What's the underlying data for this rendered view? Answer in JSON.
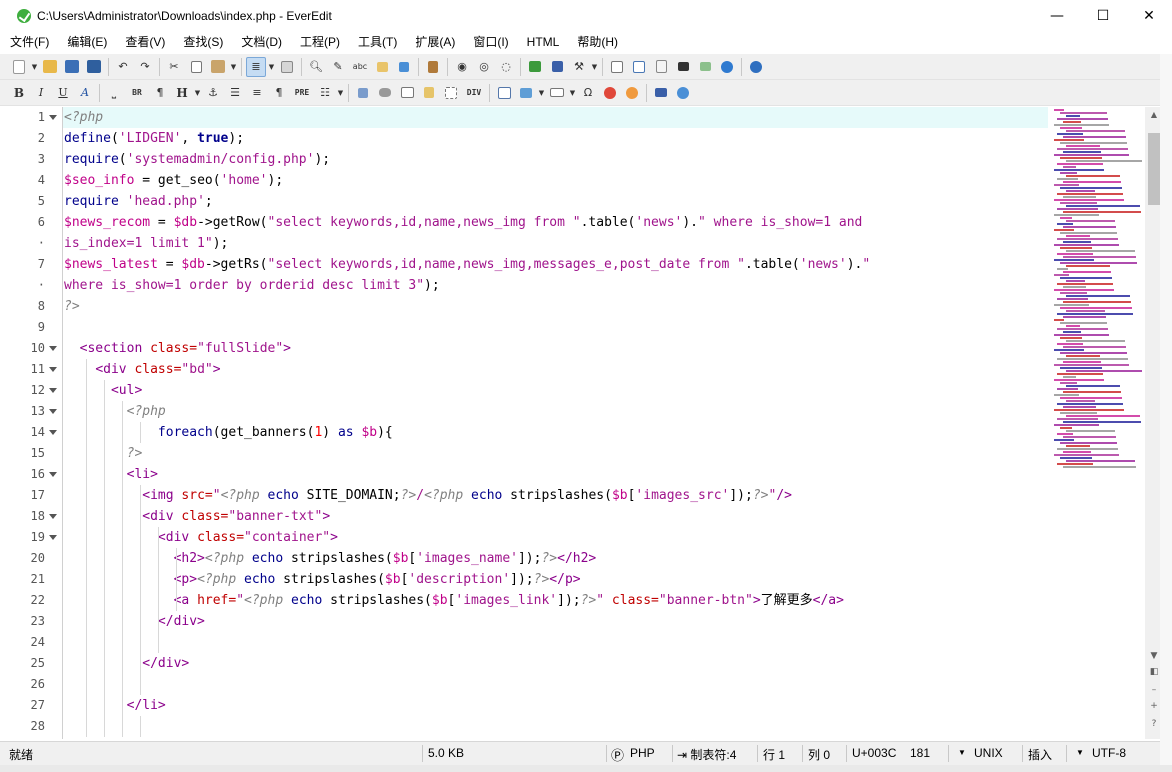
{
  "window": {
    "title": "C:\\Users\\Administrator\\Downloads\\index.php - EverEdit",
    "controls": [
      "—",
      "☐",
      "✕"
    ]
  },
  "menu": [
    "文件(F)",
    "编辑(E)",
    "查看(V)",
    "查找(S)",
    "文档(D)",
    "工程(P)",
    "工具(T)",
    "扩展(A)",
    "窗口(I)",
    "HTML",
    "帮助(H)"
  ],
  "toolbar1": {
    "icons": [
      "new-file-icon",
      "open-folder-icon",
      "save-icon",
      "save-all-icon",
      "undo-icon",
      "redo-icon",
      "cut-icon",
      "copy-icon",
      "paste-icon",
      "word-wrap-icon",
      "find-icon",
      "replace-icon",
      "spell-check-icon",
      "find-in-files-icon",
      "structure-icon",
      "column-mode-icon",
      "record-macro-icon",
      "play-macro-icon",
      "macro-list-icon",
      "plugin-icon",
      "panel-icon",
      "tools-icon",
      "explorer-icon",
      "outline-icon",
      "clipboard-icon",
      "console-icon",
      "grid-icon",
      "browser-icon",
      "help-icon"
    ]
  },
  "toolbar2": {
    "labels": [
      "B",
      "I",
      "U",
      "A",
      "BR",
      "¶",
      "H",
      "PRE",
      "DIV",
      "Ω"
    ]
  },
  "editor": {
    "gutter": [
      {
        "n": "1",
        "fold": true
      },
      {
        "n": "2",
        "fold": false
      },
      {
        "n": "3",
        "fold": false
      },
      {
        "n": "4",
        "fold": false
      },
      {
        "n": "5",
        "fold": false
      },
      {
        "n": "6",
        "fold": false
      },
      {
        "n": "·",
        "fold": false
      },
      {
        "n": "7",
        "fold": false
      },
      {
        "n": "·",
        "fold": false
      },
      {
        "n": "8",
        "fold": false
      },
      {
        "n": "9",
        "fold": false
      },
      {
        "n": "10",
        "fold": true
      },
      {
        "n": "11",
        "fold": true
      },
      {
        "n": "12",
        "fold": true
      },
      {
        "n": "13",
        "fold": true
      },
      {
        "n": "14",
        "fold": true
      },
      {
        "n": "15",
        "fold": false
      },
      {
        "n": "16",
        "fold": true
      },
      {
        "n": "17",
        "fold": false
      },
      {
        "n": "18",
        "fold": true
      },
      {
        "n": "19",
        "fold": true
      },
      {
        "n": "20",
        "fold": false
      },
      {
        "n": "21",
        "fold": false
      },
      {
        "n": "22",
        "fold": false
      },
      {
        "n": "23",
        "fold": false
      },
      {
        "n": "24",
        "fold": false
      },
      {
        "n": "25",
        "fold": false
      },
      {
        "n": "26",
        "fold": false
      },
      {
        "n": "27",
        "fold": false
      },
      {
        "n": "28",
        "fold": false
      }
    ],
    "lines": [
      {
        "guides": [],
        "current": true,
        "tokens": [
          [
            "php",
            "<?php"
          ]
        ]
      },
      {
        "guides": [],
        "tokens": [
          [
            "kw",
            "define"
          ],
          [
            "plain",
            "("
          ],
          [
            "str",
            "'LIDGEN'"
          ],
          [
            "plain",
            ", "
          ],
          [
            "bold",
            "true"
          ],
          [
            "plain",
            ");"
          ]
        ]
      },
      {
        "guides": [],
        "tokens": [
          [
            "kw",
            "require"
          ],
          [
            "plain",
            "("
          ],
          [
            "str",
            "'systemadmin/config.php'"
          ],
          [
            "plain",
            ");"
          ]
        ]
      },
      {
        "guides": [],
        "tokens": [
          [
            "var",
            "$seo_info"
          ],
          [
            "plain",
            " = get_seo("
          ],
          [
            "str",
            "'home'"
          ],
          [
            "plain",
            ");"
          ]
        ]
      },
      {
        "guides": [],
        "tokens": [
          [
            "kw",
            "require"
          ],
          [
            "plain",
            " "
          ],
          [
            "str",
            "'head.php'"
          ],
          [
            "plain",
            ";"
          ]
        ]
      },
      {
        "guides": [],
        "tokens": [
          [
            "var",
            "$news_recom"
          ],
          [
            "plain",
            " = "
          ],
          [
            "var",
            "$db"
          ],
          [
            "plain",
            "->getRow("
          ],
          [
            "str",
            "\"select keywords,id,name,news_img from \""
          ],
          [
            "plain",
            ".table("
          ],
          [
            "str",
            "'news'"
          ],
          [
            "plain",
            ")."
          ],
          [
            "str",
            "\" where is_show=1 and"
          ]
        ]
      },
      {
        "guides": [],
        "tokens": [
          [
            "str",
            "is_index=1 limit 1\""
          ],
          [
            "plain",
            ");"
          ]
        ]
      },
      {
        "guides": [],
        "tokens": [
          [
            "var",
            "$news_latest"
          ],
          [
            "plain",
            " = "
          ],
          [
            "var",
            "$db"
          ],
          [
            "plain",
            "->getRs("
          ],
          [
            "str",
            "\"select keywords,id,name,news_img,messages_e,post_date from \""
          ],
          [
            "plain",
            ".table("
          ],
          [
            "str",
            "'news'"
          ],
          [
            "plain",
            ")."
          ],
          [
            "str",
            "\""
          ]
        ]
      },
      {
        "guides": [],
        "tokens": [
          [
            "str",
            "where is_show=1 order by orderid desc limit 3\""
          ],
          [
            "plain",
            ");"
          ]
        ]
      },
      {
        "guides": [],
        "tokens": [
          [
            "php",
            "?>"
          ]
        ]
      },
      {
        "guides": [],
        "tokens": []
      },
      {
        "guides": [],
        "tokens": [
          [
            "plain",
            "  "
          ],
          [
            "tag",
            "<section "
          ],
          [
            "attr",
            "class="
          ],
          [
            "str",
            "\"fullSlide\""
          ],
          [
            "tag",
            ">"
          ]
        ]
      },
      {
        "guides": [
          22
        ],
        "tokens": [
          [
            "plain",
            "    "
          ],
          [
            "tag",
            "<div "
          ],
          [
            "attr",
            "class="
          ],
          [
            "str",
            "\"bd\""
          ],
          [
            "tag",
            ">"
          ]
        ]
      },
      {
        "guides": [
          22,
          40
        ],
        "tokens": [
          [
            "plain",
            "      "
          ],
          [
            "tag",
            "<ul>"
          ]
        ]
      },
      {
        "guides": [
          22,
          40,
          58
        ],
        "tokens": [
          [
            "plain",
            "        "
          ],
          [
            "php",
            "<?php"
          ]
        ]
      },
      {
        "guides": [
          22,
          40,
          58,
          76
        ],
        "tokens": [
          [
            "plain",
            "            "
          ],
          [
            "kw",
            "foreach"
          ],
          [
            "plain",
            "(get_banners("
          ],
          [
            "num",
            "1"
          ],
          [
            "plain",
            ") "
          ],
          [
            "kw",
            "as"
          ],
          [
            "plain",
            " "
          ],
          [
            "var",
            "$b"
          ],
          [
            "plain",
            "){"
          ]
        ]
      },
      {
        "guides": [
          22,
          40,
          58
        ],
        "tokens": [
          [
            "plain",
            "        "
          ],
          [
            "php",
            "?>"
          ]
        ]
      },
      {
        "guides": [
          22,
          40,
          58
        ],
        "tokens": [
          [
            "plain",
            "        "
          ],
          [
            "tag",
            "<li>"
          ]
        ]
      },
      {
        "guides": [
          22,
          40,
          58,
          76
        ],
        "tokens": [
          [
            "plain",
            "          "
          ],
          [
            "tag",
            "<img "
          ],
          [
            "attr",
            "src="
          ],
          [
            "str",
            "\""
          ],
          [
            "php",
            "<?php"
          ],
          [
            "plain",
            " "
          ],
          [
            "kw",
            "echo"
          ],
          [
            "plain",
            " SITE_DOMAIN;"
          ],
          [
            "php",
            "?>"
          ],
          [
            "str",
            "/"
          ],
          [
            "php",
            "<?php"
          ],
          [
            "plain",
            " "
          ],
          [
            "kw",
            "echo"
          ],
          [
            "plain",
            " stripslashes("
          ],
          [
            "var",
            "$b"
          ],
          [
            "plain",
            "["
          ],
          [
            "str",
            "'images_src'"
          ],
          [
            "plain",
            "]);"
          ],
          [
            "php",
            "?>"
          ],
          [
            "str",
            "\""
          ],
          [
            "tag",
            "/>"
          ]
        ]
      },
      {
        "guides": [
          22,
          40,
          58,
          76
        ],
        "tokens": [
          [
            "plain",
            "          "
          ],
          [
            "tag",
            "<div "
          ],
          [
            "attr",
            "class="
          ],
          [
            "str",
            "\"banner-txt\""
          ],
          [
            "tag",
            ">"
          ]
        ]
      },
      {
        "guides": [
          22,
          40,
          58,
          76,
          94
        ],
        "tokens": [
          [
            "plain",
            "            "
          ],
          [
            "tag",
            "<div "
          ],
          [
            "attr",
            "class="
          ],
          [
            "str",
            "\"container\""
          ],
          [
            "tag",
            ">"
          ]
        ]
      },
      {
        "guides": [
          22,
          40,
          58,
          76,
          94,
          112
        ],
        "tokens": [
          [
            "plain",
            "              "
          ],
          [
            "tag",
            "<h2>"
          ],
          [
            "php",
            "<?php"
          ],
          [
            "plain",
            " "
          ],
          [
            "kw",
            "echo"
          ],
          [
            "plain",
            " stripslashes("
          ],
          [
            "var",
            "$b"
          ],
          [
            "plain",
            "["
          ],
          [
            "str",
            "'images_name'"
          ],
          [
            "plain",
            "]);"
          ],
          [
            "php",
            "?>"
          ],
          [
            "tag",
            "</h2>"
          ]
        ]
      },
      {
        "guides": [
          22,
          40,
          58,
          76,
          94,
          112
        ],
        "tokens": [
          [
            "plain",
            "              "
          ],
          [
            "tag",
            "<p>"
          ],
          [
            "php",
            "<?php"
          ],
          [
            "plain",
            " "
          ],
          [
            "kw",
            "echo"
          ],
          [
            "plain",
            " stripslashes("
          ],
          [
            "var",
            "$b"
          ],
          [
            "plain",
            "["
          ],
          [
            "str",
            "'description'"
          ],
          [
            "plain",
            "]);"
          ],
          [
            "php",
            "?>"
          ],
          [
            "tag",
            "</p>"
          ]
        ]
      },
      {
        "guides": [
          22,
          40,
          58,
          76,
          94,
          112
        ],
        "tokens": [
          [
            "plain",
            "              "
          ],
          [
            "tag",
            "<a "
          ],
          [
            "attr",
            "href="
          ],
          [
            "str",
            "\""
          ],
          [
            "php",
            "<?php"
          ],
          [
            "plain",
            " "
          ],
          [
            "kw",
            "echo"
          ],
          [
            "plain",
            " stripslashes("
          ],
          [
            "var",
            "$b"
          ],
          [
            "plain",
            "["
          ],
          [
            "str",
            "'images_link'"
          ],
          [
            "plain",
            "]);"
          ],
          [
            "php",
            "?>"
          ],
          [
            "str",
            "\""
          ],
          [
            "plain",
            " "
          ],
          [
            "attr",
            "class="
          ],
          [
            "str",
            "\"banner-btn\""
          ],
          [
            "tag",
            ">"
          ],
          [
            "plain",
            "了解更多"
          ],
          [
            "tag",
            "</a>"
          ]
        ]
      },
      {
        "guides": [
          22,
          40,
          58,
          76,
          94
        ],
        "tokens": [
          [
            "plain",
            "            "
          ],
          [
            "tag",
            "</div>"
          ]
        ]
      },
      {
        "guides": [
          22,
          40,
          58,
          76,
          94
        ],
        "tokens": []
      },
      {
        "guides": [
          22,
          40,
          58,
          76
        ],
        "tokens": [
          [
            "plain",
            "          "
          ],
          [
            "tag",
            "</div>"
          ]
        ]
      },
      {
        "guides": [
          22,
          40,
          58,
          76
        ],
        "tokens": []
      },
      {
        "guides": [
          22,
          40,
          58
        ],
        "tokens": [
          [
            "plain",
            "        "
          ],
          [
            "tag",
            "</li>"
          ]
        ]
      },
      {
        "guides": [
          22,
          40,
          58,
          76
        ],
        "tokens": []
      }
    ]
  },
  "status": {
    "ready": "就绪",
    "size": "5.0 KB",
    "lang_icon": "Ⓟ",
    "lang": "PHP",
    "tab": "⇥ 制表符:4",
    "row": "行 1",
    "col": "列 0",
    "unicode": "U+003C",
    "code": "181",
    "eol": "UNIX",
    "mode": "插入",
    "encoding": "UTF-8"
  },
  "colors": {
    "current_line": "#e6fafa",
    "keyword": "#00008b",
    "string": "#a0148c",
    "variable": "#c00088",
    "tag": "#8b008b",
    "attribute": "#c00000",
    "php_tag": "#808080"
  }
}
